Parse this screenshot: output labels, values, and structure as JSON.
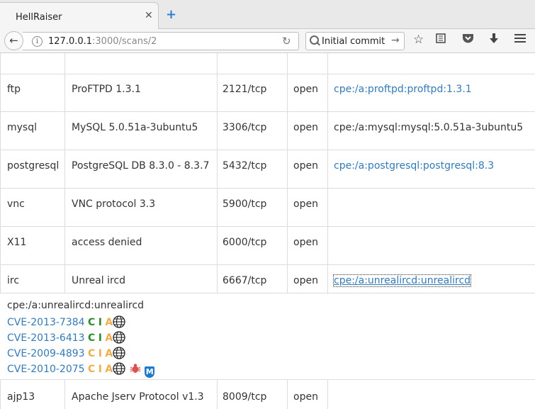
{
  "browser": {
    "tab_title": "HellRaiser",
    "tab_close": "✕",
    "new_tab": "+",
    "url_host": "127.0.0.1",
    "url_path": ":3000/scans/2",
    "search_value": "Initial commit"
  },
  "services": [
    {
      "name": "ftp",
      "product": "ProFTPD 1.3.1",
      "port": "2121/tcp",
      "state": "open",
      "cpe": "cpe:/a:proftpd:proftpd:1.3.1",
      "cpe_link": true
    },
    {
      "name": "mysql",
      "product": "MySQL 5.0.51a-3ubuntu5",
      "port": "3306/tcp",
      "state": "open",
      "cpe": "cpe:/a:mysql:mysql:5.0.51a-3ubuntu5",
      "cpe_link": false
    },
    {
      "name": "postgresql",
      "product": "PostgreSQL DB 8.3.0 - 8.3.7",
      "port": "5432/tcp",
      "state": "open",
      "cpe": "cpe:/a:postgresql:postgresql:8.3",
      "cpe_link": true
    },
    {
      "name": "vnc",
      "product": "VNC protocol 3.3",
      "port": "5900/tcp",
      "state": "open",
      "cpe": "",
      "cpe_link": false
    },
    {
      "name": "X11",
      "product": "access denied",
      "port": "6000/tcp",
      "state": "open",
      "cpe": "",
      "cpe_link": false
    },
    {
      "name": "irc",
      "product": "Unreal ircd",
      "port": "6667/tcp",
      "state": "open",
      "cpe": "cpe:/a:unrealircd:unrealircd",
      "cpe_link": true
    },
    {
      "name": "ajp13",
      "product": "Apache Jserv Protocol v1.3",
      "port": "8009/tcp",
      "state": "open",
      "cpe": "",
      "cpe_link": false
    }
  ],
  "vuln_panel": {
    "cpe_heading": "cpe:/a:unrealircd:unrealircd",
    "cves": [
      {
        "id": "CVE-2013-7384",
        "c": "C",
        "i": "I",
        "a": "A",
        "c_color": "#2e8b2e",
        "i_color": "#2e8b2e",
        "extras": [
          "globe-icon"
        ]
      },
      {
        "id": "CVE-2013-6413",
        "c": "C",
        "i": "I",
        "a": "A",
        "c_color": "#2e8b2e",
        "i_color": "#2e8b2e",
        "extras": [
          "globe-icon"
        ]
      },
      {
        "id": "CVE-2009-4893",
        "c": "C",
        "i": "I",
        "a": "A",
        "c_color": "#f0ad4e",
        "i_color": "#f0ad4e",
        "extras": [
          "globe-icon"
        ]
      },
      {
        "id": "CVE-2010-2075",
        "c": "C",
        "i": "I",
        "a": "A",
        "c_color": "#f0ad4e",
        "i_color": "#f0ad4e",
        "extras": [
          "globe-icon",
          "bug-icon",
          "metasploit-icon"
        ]
      }
    ]
  }
}
